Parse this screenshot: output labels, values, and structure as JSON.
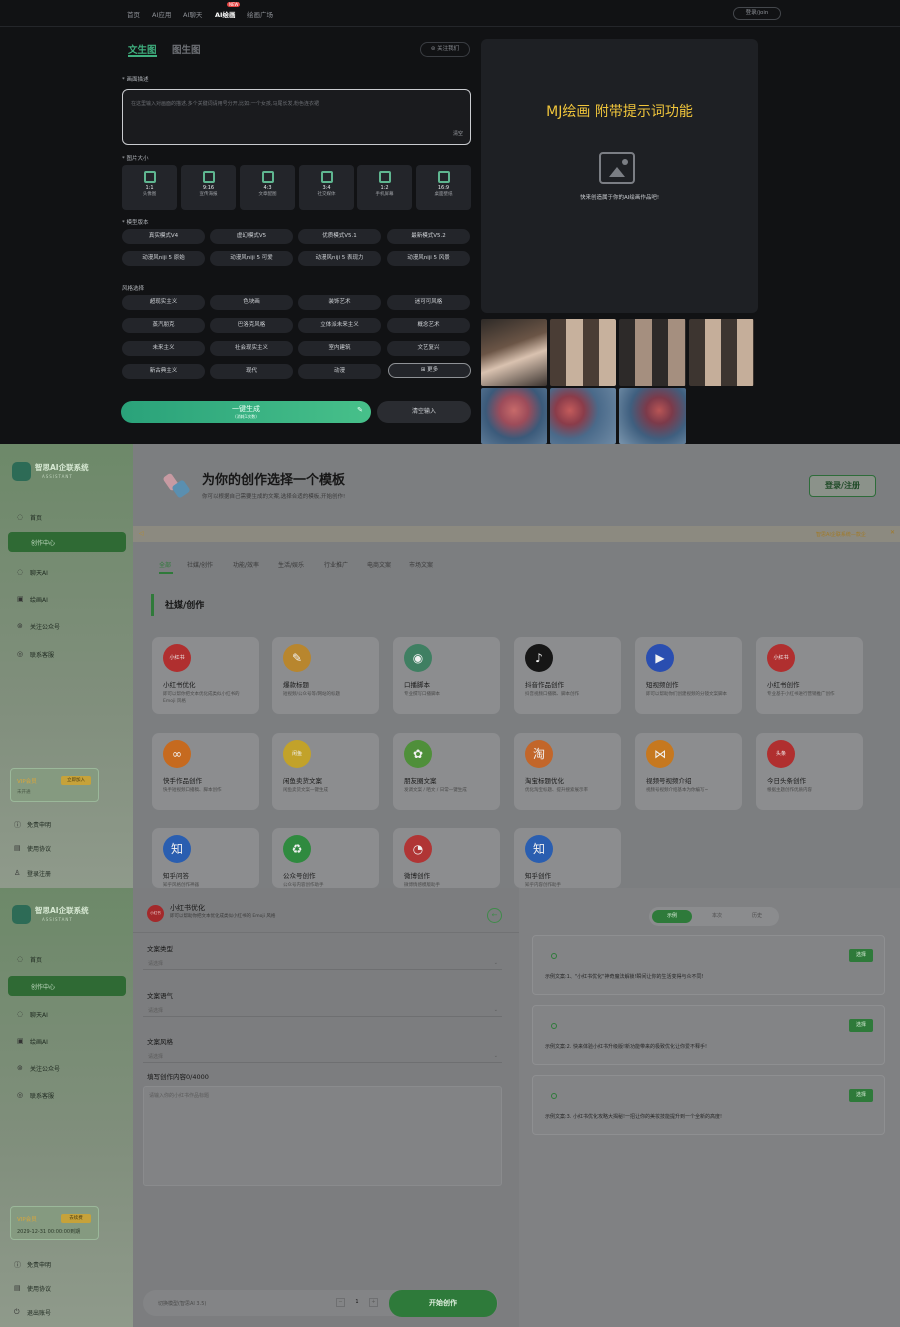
{
  "mj": {
    "nav": [
      "首页",
      "AI应用",
      "AI聊天",
      "AI绘画",
      "绘画广场"
    ],
    "nav_hot": "NEW",
    "login": "登录/join",
    "tabs": [
      "文生图",
      "图生图"
    ],
    "follow": "关注我们",
    "desc_label": "* 画面描述",
    "desc_placeholder": "在这里输入对画面的描述,多个关键词请用号分开,比如:一个女孩,马尾长发,粉色连衣裙",
    "clear": "清空",
    "size_label": "* 图片大小",
    "ratios": [
      {
        "r": "1:1",
        "n": "头像图"
      },
      {
        "r": "9:16",
        "n": "宣传海报"
      },
      {
        "r": "4:3",
        "n": "文章配图"
      },
      {
        "r": "3:4",
        "n": "社交媒体"
      },
      {
        "r": "1:2",
        "n": "手机屏幕"
      },
      {
        "r": "16:9",
        "n": "桌面壁纸"
      }
    ],
    "version_label": "* 模型版本",
    "versions": [
      "真实模式V4",
      "虚幻模式V5",
      "优质模式V5.1",
      "最新模式V5.2",
      "动漫风niji 5 原始",
      "动漫风niji 5 可爱",
      "动漫风niji 5 表现力",
      "动漫风niji 5 风景"
    ],
    "style_label": "风格选择",
    "styles": [
      "超现实主义",
      "色块画",
      "装饰艺术",
      "迷可可风格",
      "蒸汽朋克",
      "巴洛克风格",
      "立体派未来主义",
      "概念艺术",
      "未来主义",
      "社会现实主义",
      "室内建筑",
      "文艺复兴",
      "新古典主义",
      "现代",
      "动漫"
    ],
    "more": "更多",
    "generate": "一键生成",
    "generate_sub": "(消耗1次数)",
    "reset": "清空输入",
    "promo": "MJ绘画 附带提示词功能",
    "empty_hint": "快来创造属于你的AI绘画作品吧!"
  },
  "tpl": {
    "brand": "智思AI企联系统",
    "brand_sub": "ASSISTANT",
    "side": [
      "首页",
      "创作中心",
      "聊天AI",
      "绘画AI",
      "关注公众号",
      "联系客服"
    ],
    "vip": "VIP会员",
    "vip_btn": "立即加入",
    "vip_sub": "未开通",
    "side_bottom": [
      "免责申明",
      "使用协议",
      "登录注册"
    ],
    "title": "为你的创作选择一个模板",
    "subtitle": "你可以根据自己需要生成的文案,选择合适的模板,开始创作!",
    "login": "登录/注册",
    "notice": "智思AI企联系统—款企",
    "cats": [
      "全部",
      "社媒/创作",
      "功能/效率",
      "生活/娱乐",
      "行业推广",
      "电商文案",
      "市场文案"
    ],
    "section": "社媒/创作",
    "cards": [
      {
        "t": "小红书优化",
        "d": "即可以帮你把文本优化成类似小红书的 Emoji 风格",
        "c": "#b02f2f",
        "i": "小红书"
      },
      {
        "t": "爆款标题",
        "d": "短视频/公众号等/网站的标题",
        "c": "#b8862e",
        "i": "✎"
      },
      {
        "t": "口播脚本",
        "d": "专业撰写口播脚本",
        "c": "#3f7f62",
        "i": "◉"
      },
      {
        "t": "抖音作品创作",
        "d": "抖音视频口播稿、脚本创作",
        "c": "#161616",
        "i": "♪"
      },
      {
        "t": "短视频创作",
        "d": "即可以帮助你们创建视频的分镜文案脚本",
        "c": "#2a4eb0",
        "i": "▶"
      },
      {
        "t": "小红书创作",
        "d": "专业基于小红书进行营销推广创作",
        "c": "#b02f2f",
        "i": "小红书"
      },
      {
        "t": "快手作品创作",
        "d": "快手短视频口播稿、脚本创作",
        "c": "#c66a1f",
        "i": "∞"
      },
      {
        "t": "闲鱼卖货文案",
        "d": "闲鱼卖货文案一键生成",
        "c": "#c2a22a",
        "i": "闲鱼"
      },
      {
        "t": "朋友圈文案",
        "d": "发调文案 / 晒文 / 日常一键生成",
        "c": "#4f8f3a",
        "i": "✿"
      },
      {
        "t": "淘宝标题优化",
        "d": "优化淘宝标题、提升搜索展示率",
        "c": "#c2662a",
        "i": "淘"
      },
      {
        "t": "视频号视频介绍",
        "d": "视频号视频介绍基本为你编写~",
        "c": "#c6781f",
        "i": "⋈"
      },
      {
        "t": "今日头条创作",
        "d": "根据主题创作优质内容",
        "c": "#b02f2f",
        "i": "头条"
      },
      {
        "t": "知乎问答",
        "d": "知乎风格创作神器",
        "c": "#2a5eb0",
        "i": "知"
      },
      {
        "t": "公众号创作",
        "d": "公众号内容创作助手",
        "c": "#2f8a3f",
        "i": "♻"
      },
      {
        "t": "微博创作",
        "d": "微博情感模版助手",
        "c": "#b03535",
        "i": "◔"
      },
      {
        "t": "知乎创作",
        "d": "知乎内容创作助手",
        "c": "#2a5eb0",
        "i": "知"
      }
    ]
  },
  "edit": {
    "side": [
      "首页",
      "创作中心",
      "聊天AI",
      "绘画AI",
      "关注公众号",
      "联系客服"
    ],
    "vip": "VIP会员",
    "vip_btn": "去续费",
    "vip_date": "2029-12-31 00:00:00到期",
    "side_bottom": [
      "免责申明",
      "使用协议",
      "退出账号"
    ],
    "tpl_icon": "小红书",
    "tpl_name": "小红书优化",
    "tpl_desc": "即可以帮助你把文本优化成类似小红书的 Emoji 风格",
    "type_label": "文案类型",
    "tone_label": "文案语气",
    "style_label": "文案风格",
    "select_ph": "请选择",
    "content_label": "填写创作内容0/4000",
    "content_ph": "请输入你的小红书作品标题",
    "model": "切换模型(智思AI 3.5)",
    "qty": "1",
    "start": "开始创作",
    "tabs": [
      "示例",
      "本次",
      "历史"
    ],
    "examples": [
      "示例文案:1、\"小红书优化\"神奇魔法解锁!瞬间让你的生活变得与众不同!",
      "示例文案:2. 快来体验小红书升级版!新功能带来的极致优化让你爱不释手!",
      "示例文案:3. 小红书优化攻略大揭秘!一招让你的美妆技能提升到一个全新的高度!"
    ],
    "pick": "选择"
  }
}
